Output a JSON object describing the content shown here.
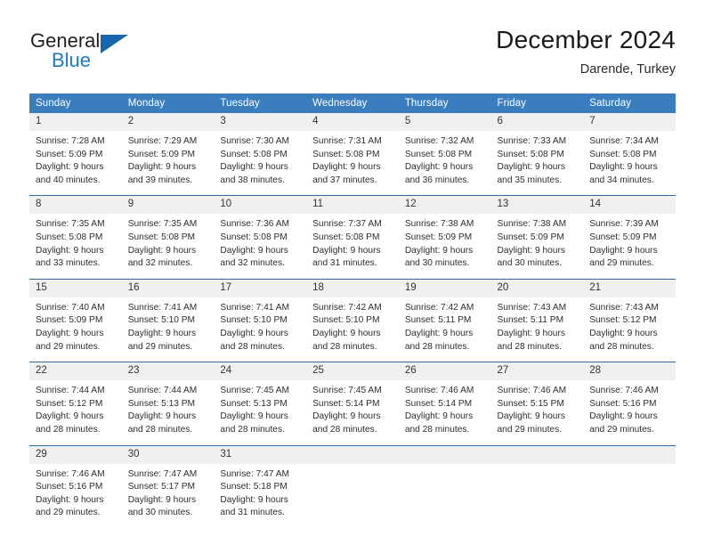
{
  "logo": {
    "word_top": "General",
    "word_bottom": "Blue",
    "accent_color": "#1667b0"
  },
  "header": {
    "title": "December 2024",
    "subtitle": "Darende, Turkey"
  },
  "theme": {
    "header_bg": "#3a7ebf",
    "row_divider": "#2e6da4",
    "daynum_bg": "#f0f0f0"
  },
  "weekdays": [
    "Sunday",
    "Monday",
    "Tuesday",
    "Wednesday",
    "Thursday",
    "Friday",
    "Saturday"
  ],
  "weeks": [
    [
      {
        "day": "1",
        "sunrise": "Sunrise: 7:28 AM",
        "sunset": "Sunset: 5:09 PM",
        "daylight1": "Daylight: 9 hours",
        "daylight2": "and 40 minutes."
      },
      {
        "day": "2",
        "sunrise": "Sunrise: 7:29 AM",
        "sunset": "Sunset: 5:09 PM",
        "daylight1": "Daylight: 9 hours",
        "daylight2": "and 39 minutes."
      },
      {
        "day": "3",
        "sunrise": "Sunrise: 7:30 AM",
        "sunset": "Sunset: 5:08 PM",
        "daylight1": "Daylight: 9 hours",
        "daylight2": "and 38 minutes."
      },
      {
        "day": "4",
        "sunrise": "Sunrise: 7:31 AM",
        "sunset": "Sunset: 5:08 PM",
        "daylight1": "Daylight: 9 hours",
        "daylight2": "and 37 minutes."
      },
      {
        "day": "5",
        "sunrise": "Sunrise: 7:32 AM",
        "sunset": "Sunset: 5:08 PM",
        "daylight1": "Daylight: 9 hours",
        "daylight2": "and 36 minutes."
      },
      {
        "day": "6",
        "sunrise": "Sunrise: 7:33 AM",
        "sunset": "Sunset: 5:08 PM",
        "daylight1": "Daylight: 9 hours",
        "daylight2": "and 35 minutes."
      },
      {
        "day": "7",
        "sunrise": "Sunrise: 7:34 AM",
        "sunset": "Sunset: 5:08 PM",
        "daylight1": "Daylight: 9 hours",
        "daylight2": "and 34 minutes."
      }
    ],
    [
      {
        "day": "8",
        "sunrise": "Sunrise: 7:35 AM",
        "sunset": "Sunset: 5:08 PM",
        "daylight1": "Daylight: 9 hours",
        "daylight2": "and 33 minutes."
      },
      {
        "day": "9",
        "sunrise": "Sunrise: 7:35 AM",
        "sunset": "Sunset: 5:08 PM",
        "daylight1": "Daylight: 9 hours",
        "daylight2": "and 32 minutes."
      },
      {
        "day": "10",
        "sunrise": "Sunrise: 7:36 AM",
        "sunset": "Sunset: 5:08 PM",
        "daylight1": "Daylight: 9 hours",
        "daylight2": "and 32 minutes."
      },
      {
        "day": "11",
        "sunrise": "Sunrise: 7:37 AM",
        "sunset": "Sunset: 5:08 PM",
        "daylight1": "Daylight: 9 hours",
        "daylight2": "and 31 minutes."
      },
      {
        "day": "12",
        "sunrise": "Sunrise: 7:38 AM",
        "sunset": "Sunset: 5:09 PM",
        "daylight1": "Daylight: 9 hours",
        "daylight2": "and 30 minutes."
      },
      {
        "day": "13",
        "sunrise": "Sunrise: 7:38 AM",
        "sunset": "Sunset: 5:09 PM",
        "daylight1": "Daylight: 9 hours",
        "daylight2": "and 30 minutes."
      },
      {
        "day": "14",
        "sunrise": "Sunrise: 7:39 AM",
        "sunset": "Sunset: 5:09 PM",
        "daylight1": "Daylight: 9 hours",
        "daylight2": "and 29 minutes."
      }
    ],
    [
      {
        "day": "15",
        "sunrise": "Sunrise: 7:40 AM",
        "sunset": "Sunset: 5:09 PM",
        "daylight1": "Daylight: 9 hours",
        "daylight2": "and 29 minutes."
      },
      {
        "day": "16",
        "sunrise": "Sunrise: 7:41 AM",
        "sunset": "Sunset: 5:10 PM",
        "daylight1": "Daylight: 9 hours",
        "daylight2": "and 29 minutes."
      },
      {
        "day": "17",
        "sunrise": "Sunrise: 7:41 AM",
        "sunset": "Sunset: 5:10 PM",
        "daylight1": "Daylight: 9 hours",
        "daylight2": "and 28 minutes."
      },
      {
        "day": "18",
        "sunrise": "Sunrise: 7:42 AM",
        "sunset": "Sunset: 5:10 PM",
        "daylight1": "Daylight: 9 hours",
        "daylight2": "and 28 minutes."
      },
      {
        "day": "19",
        "sunrise": "Sunrise: 7:42 AM",
        "sunset": "Sunset: 5:11 PM",
        "daylight1": "Daylight: 9 hours",
        "daylight2": "and 28 minutes."
      },
      {
        "day": "20",
        "sunrise": "Sunrise: 7:43 AM",
        "sunset": "Sunset: 5:11 PM",
        "daylight1": "Daylight: 9 hours",
        "daylight2": "and 28 minutes."
      },
      {
        "day": "21",
        "sunrise": "Sunrise: 7:43 AM",
        "sunset": "Sunset: 5:12 PM",
        "daylight1": "Daylight: 9 hours",
        "daylight2": "and 28 minutes."
      }
    ],
    [
      {
        "day": "22",
        "sunrise": "Sunrise: 7:44 AM",
        "sunset": "Sunset: 5:12 PM",
        "daylight1": "Daylight: 9 hours",
        "daylight2": "and 28 minutes."
      },
      {
        "day": "23",
        "sunrise": "Sunrise: 7:44 AM",
        "sunset": "Sunset: 5:13 PM",
        "daylight1": "Daylight: 9 hours",
        "daylight2": "and 28 minutes."
      },
      {
        "day": "24",
        "sunrise": "Sunrise: 7:45 AM",
        "sunset": "Sunset: 5:13 PM",
        "daylight1": "Daylight: 9 hours",
        "daylight2": "and 28 minutes."
      },
      {
        "day": "25",
        "sunrise": "Sunrise: 7:45 AM",
        "sunset": "Sunset: 5:14 PM",
        "daylight1": "Daylight: 9 hours",
        "daylight2": "and 28 minutes."
      },
      {
        "day": "26",
        "sunrise": "Sunrise: 7:46 AM",
        "sunset": "Sunset: 5:14 PM",
        "daylight1": "Daylight: 9 hours",
        "daylight2": "and 28 minutes."
      },
      {
        "day": "27",
        "sunrise": "Sunrise: 7:46 AM",
        "sunset": "Sunset: 5:15 PM",
        "daylight1": "Daylight: 9 hours",
        "daylight2": "and 29 minutes."
      },
      {
        "day": "28",
        "sunrise": "Sunrise: 7:46 AM",
        "sunset": "Sunset: 5:16 PM",
        "daylight1": "Daylight: 9 hours",
        "daylight2": "and 29 minutes."
      }
    ],
    [
      {
        "day": "29",
        "sunrise": "Sunrise: 7:46 AM",
        "sunset": "Sunset: 5:16 PM",
        "daylight1": "Daylight: 9 hours",
        "daylight2": "and 29 minutes."
      },
      {
        "day": "30",
        "sunrise": "Sunrise: 7:47 AM",
        "sunset": "Sunset: 5:17 PM",
        "daylight1": "Daylight: 9 hours",
        "daylight2": "and 30 minutes."
      },
      {
        "day": "31",
        "sunrise": "Sunrise: 7:47 AM",
        "sunset": "Sunset: 5:18 PM",
        "daylight1": "Daylight: 9 hours",
        "daylight2": "and 31 minutes."
      },
      {
        "day": "",
        "sunrise": "",
        "sunset": "",
        "daylight1": "",
        "daylight2": ""
      },
      {
        "day": "",
        "sunrise": "",
        "sunset": "",
        "daylight1": "",
        "daylight2": ""
      },
      {
        "day": "",
        "sunrise": "",
        "sunset": "",
        "daylight1": "",
        "daylight2": ""
      },
      {
        "day": "",
        "sunrise": "",
        "sunset": "",
        "daylight1": "",
        "daylight2": ""
      }
    ]
  ]
}
